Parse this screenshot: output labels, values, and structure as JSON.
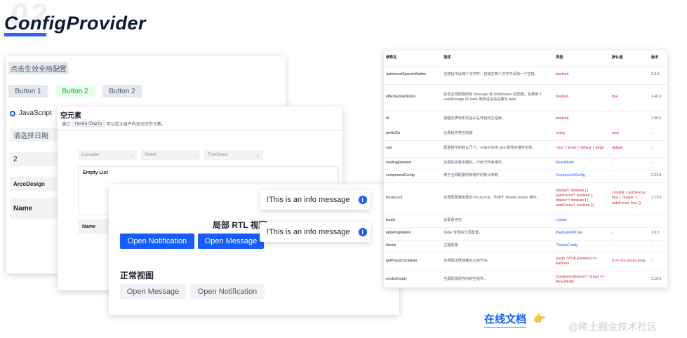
{
  "header": {
    "big_number": "02",
    "title": "ConfigProvider"
  },
  "left_demo": {
    "global_config_button": "点击生效全局配置",
    "buttons": [
      "Button 1",
      "Button 2",
      "Button 2"
    ],
    "radio_label": "JavaScript",
    "date_placeholder": "请选择日期",
    "number_value": "2",
    "tag_label": "ArcoDesign",
    "table_header": "Name"
  },
  "empty_demo": {
    "title": "空元素",
    "desc_prefix": "通过",
    "desc_code": "renderEmpty",
    "desc_suffix": "可以定义组件内显示的空元素。",
    "selects": [
      "Cascader",
      "Select",
      "TreeSelect"
    ],
    "empty_list": "Empty List",
    "table_header": "Name"
  },
  "rtl_demo": {
    "rtl_title": "局部 RTL 视图",
    "open_notification": "Open Notification",
    "open_message": "Open Message",
    "normal_title": "正常视图",
    "normal_open_message": "Open Message",
    "normal_open_notification": "Open Notification"
  },
  "messages": [
    "!This is an info message",
    "!This is an info message"
  ],
  "api_table": {
    "headers": [
      "参数名",
      "描述",
      "类型",
      "默认值",
      "版本"
    ],
    "rows": [
      {
        "param": "autoInsertSpaceInButton",
        "desc": "当按钮中是两个汉字时，自动在两个汉字中添加一个空格。",
        "type": "boolean",
        "def": "-",
        "ver": "2.3.0"
      },
      {
        "param": "effectGlobalNotice",
        "desc": "是否全局配置所有 Message 和 Notification 的配置。如果用了 useMessage 的 hook 用新语言请设置为 false",
        "type": "boolean",
        "def": "true",
        "ver": "2.40.0"
      },
      {
        "param": "rtl",
        "desc": "视图的表现形式是从右开始向左结束。",
        "type": "boolean",
        "def": "-",
        "ver": "2.36.0"
      },
      {
        "param": "prefixCls",
        "desc": "全局组件类名前缀",
        "type": "string",
        "def": "arco",
        "ver": "-"
      },
      {
        "param": "size",
        "desc": "配置组件的默认尺寸，只会对支持 size 属性的组件生效。",
        "type": "'mini' | 'small' | 'default' | 'large'",
        "def": "default",
        "ver": "-"
      },
      {
        "param": "loadingElement",
        "desc": "全局的加载中图标，作用于所有组件。",
        "type": "ReactNode",
        "def": "-",
        "ver": "-",
        "link": true
      },
      {
        "param": "componentConfig",
        "desc": "用于全局配置所有组件的默认参数",
        "type": "ComponentConfig",
        "def": "-",
        "ver": "2.23.0",
        "link": true
      },
      {
        "param": "focusLock",
        "desc": "全局配置弹出框的 focusLock，作用于 Modal Drawer 组件。",
        "type": "{modal?: boolean | { autoFocus?: boolean }; drawer?: boolean | { autoFocus?: boolean };}",
        "def": "{ modal: { autoFocus: true }, drawer: { autoFocus: true }}",
        "ver": "2.13.0"
      },
      {
        "param": "locale",
        "desc": "设置语言包",
        "type": "Locale",
        "def": "-",
        "ver": "-",
        "link": true
      },
      {
        "param": "tablePagination",
        "desc": "Table 全局的分页配置。",
        "type": "PaginationProps",
        "def": "-",
        "ver": "2.6.0",
        "link": true
      },
      {
        "param": "theme",
        "desc": "主题配置",
        "type": "ThemeConfig",
        "def": "-",
        "ver": "-",
        "link": true
      },
      {
        "param": "getPopupContainer",
        "desc": "全局弹出框挂载的父级节点。",
        "type": "(node: HTMLElement) => Element",
        "def": "() => document.body",
        "ver": "-"
      },
      {
        "param": "renderEmpty",
        "desc": "全局配置组件内的空组件。",
        "type": "(componentName?: string) => ReactNode",
        "def": "-",
        "ver": "2.10.0"
      }
    ]
  },
  "online_docs": "在线文档",
  "hand_icon": "pointing-hand-icon",
  "watermark": "@稀土掘金技术社区",
  "colors": {
    "primary": "#165dff",
    "success": "#00b42a",
    "danger": "#cb2634"
  }
}
